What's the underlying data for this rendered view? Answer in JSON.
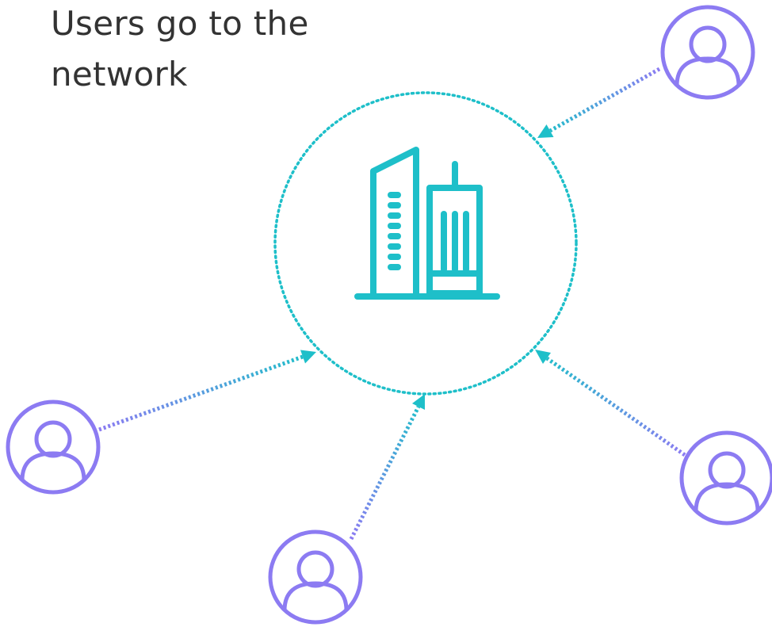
{
  "title": {
    "line1": "Users go to the",
    "line2": "network"
  },
  "nodes": {
    "center": {
      "icon": "office-building-icon"
    },
    "users": [
      {
        "id": "top-right",
        "icon": "user-icon"
      },
      {
        "id": "left",
        "icon": "user-icon"
      },
      {
        "id": "bottom",
        "icon": "user-icon"
      },
      {
        "id": "right",
        "icon": "user-icon"
      }
    ]
  },
  "colors": {
    "teal": "#1EBFC9",
    "purple": "#8C7BF2",
    "text": "#333333",
    "background": "#FFFFFF"
  }
}
